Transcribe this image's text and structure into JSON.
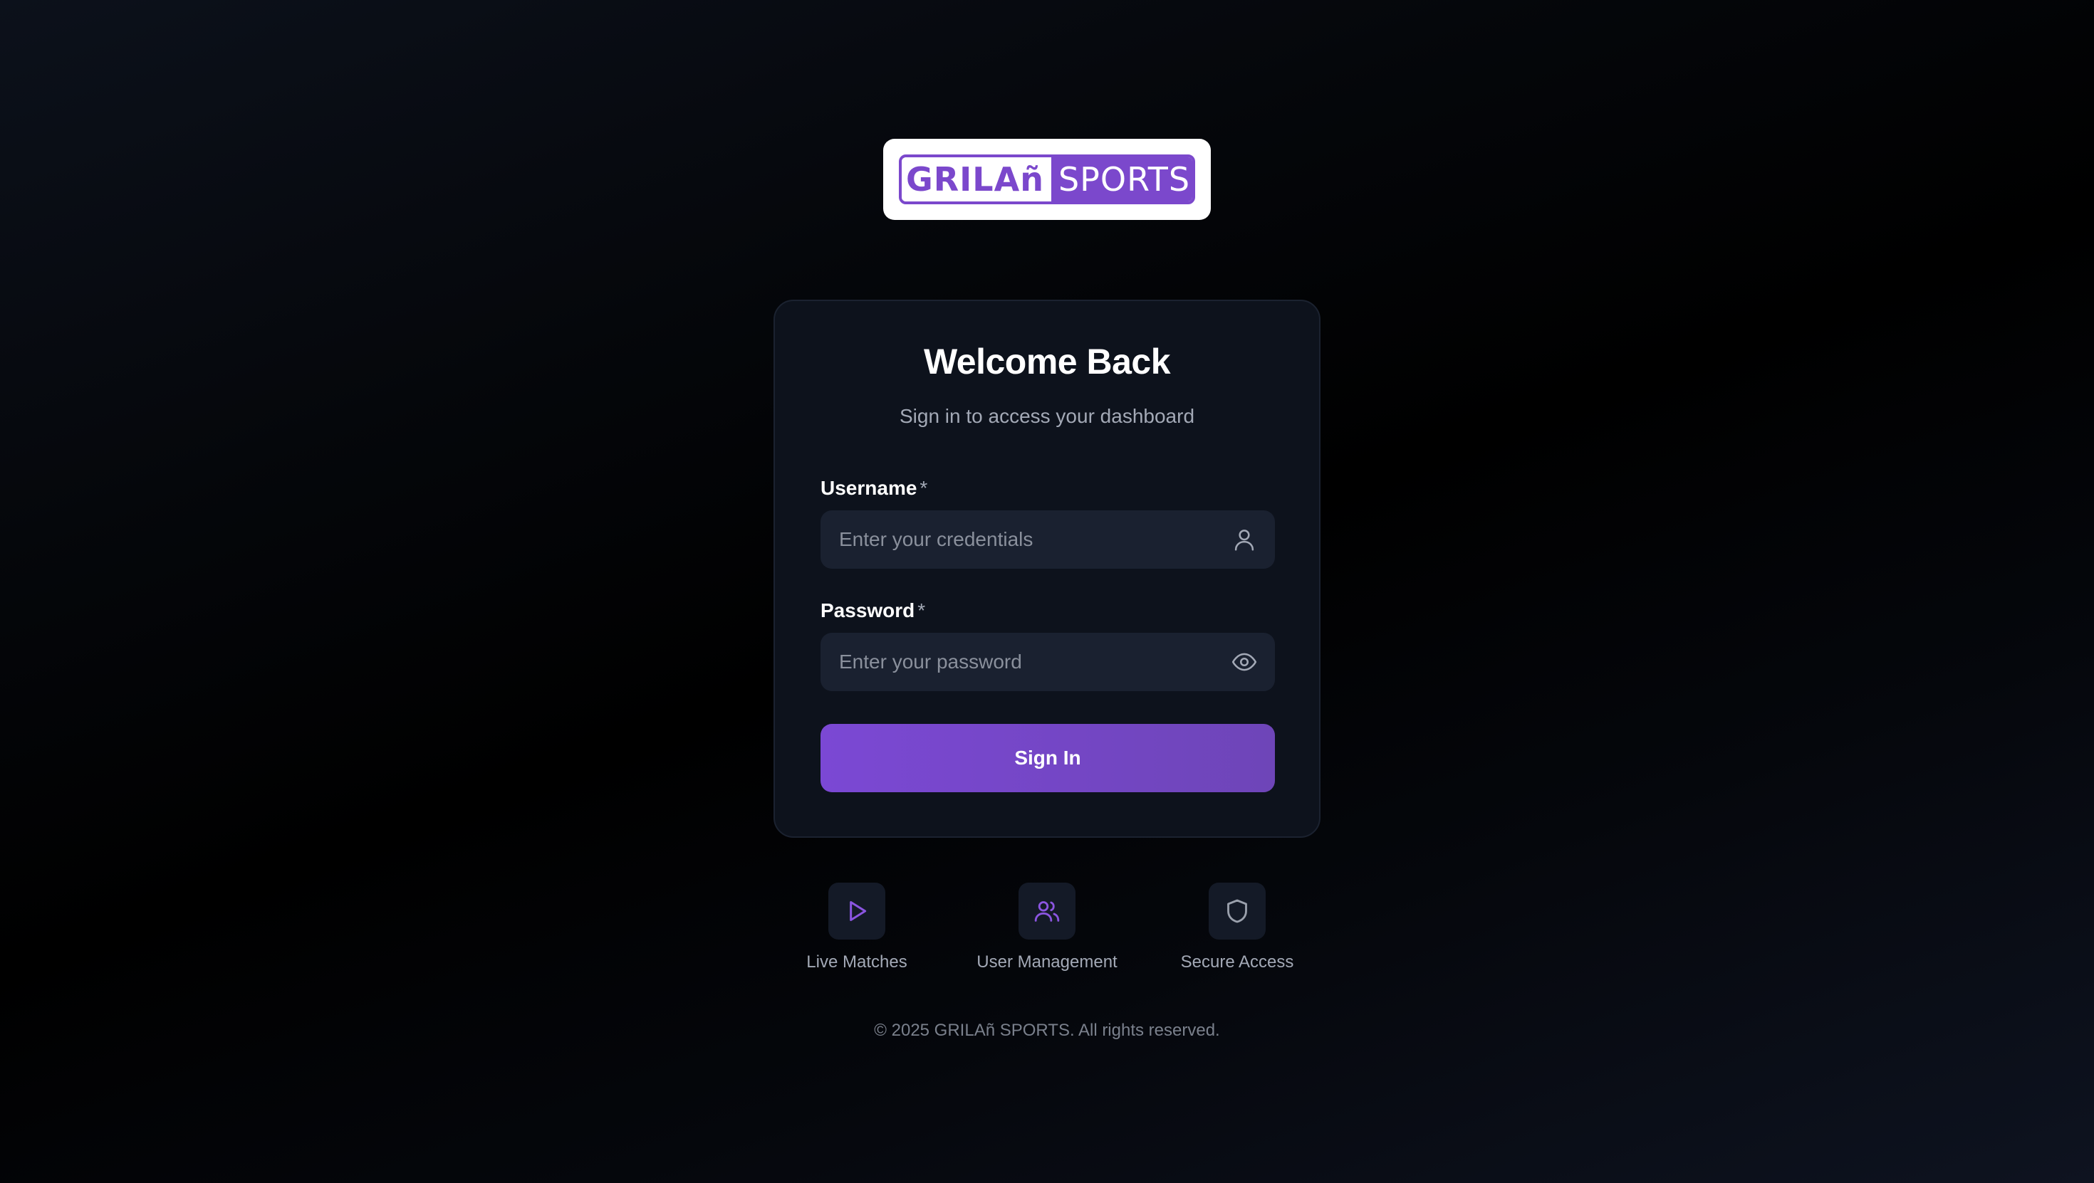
{
  "logo": {
    "part1": "GRILAñ",
    "part2": "SPORTS"
  },
  "login": {
    "title": "Welcome Back",
    "subtitle": "Sign in to access your dashboard",
    "username_label": "Username",
    "username_required": "*",
    "username_placeholder": "Enter your credentials",
    "username_value": "",
    "password_label": "Password",
    "password_required": "*",
    "password_placeholder": "Enter your password",
    "password_value": "",
    "submit_label": "Sign In"
  },
  "features": [
    {
      "label": "Live Matches",
      "icon": "play-icon"
    },
    {
      "label": "User Management",
      "icon": "users-icon"
    },
    {
      "label": "Secure Access",
      "icon": "shield-icon"
    }
  ],
  "footer": {
    "copyright": "© 2025 GRILAñ SPORTS. All rights reserved."
  },
  "colors": {
    "accent": "#7b48cc",
    "card_bg": "#0d121c",
    "input_bg": "#1a2130",
    "muted_text": "#a3a9b6"
  }
}
